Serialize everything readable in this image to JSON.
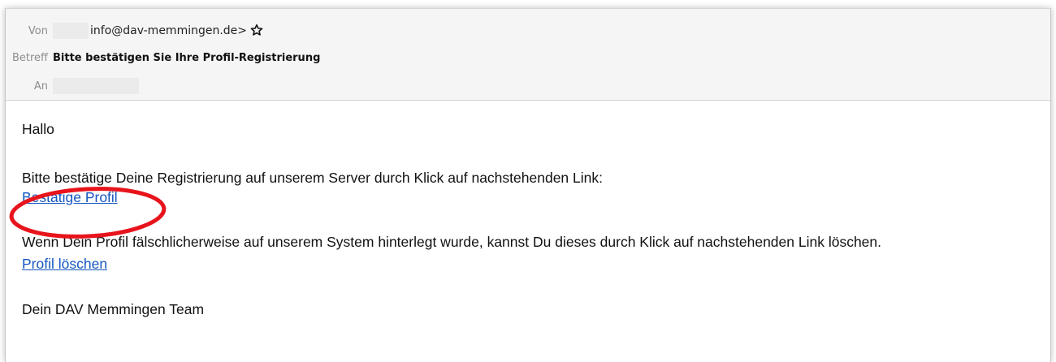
{
  "header": {
    "from_label": "Von",
    "from_email": "info@dav-memmingen.de>",
    "star_icon": "star-outline-icon",
    "subject_label": "Betreff",
    "subject": "Bitte bestätigen Sie Ihre Profil-Registrierung",
    "to_label": "An"
  },
  "body": {
    "greeting": "Hallo",
    "paragraph1": "Bitte bestätige Deine Registrierung auf unserem Server durch Klick auf nachstehenden Link:",
    "confirm_link": "Bestätige Profil",
    "paragraph2": "Wenn Dein Profil fälschlicherweise auf unserem System hinterlegt wurde, kannst Du dieses durch Klick auf nachstehenden Link löschen.",
    "delete_link": "Profil löschen",
    "signoff": "Dein DAV Memmingen Team"
  },
  "annotation": {
    "shape": "ellipse",
    "color": "#e8141c"
  },
  "colors": {
    "link": "#1557c0",
    "header_bg": "#f5f5f5"
  }
}
